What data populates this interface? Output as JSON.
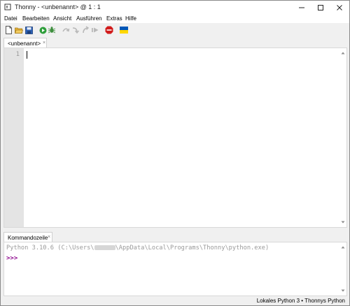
{
  "window": {
    "title": "Thonny  -  <unbenannt>  @  1 : 1"
  },
  "menu": {
    "items": [
      "Datei",
      "Bearbeiten",
      "Ansicht",
      "Ausführen",
      "Extras",
      "Hilfe"
    ]
  },
  "toolbar": {
    "icons": [
      "new-file-icon",
      "open-folder-icon",
      "save-icon",
      "run-icon",
      "debug-icon",
      "step-over-icon",
      "step-into-icon",
      "step-out-icon",
      "resume-icon",
      "stop-icon",
      "ukraine-flag-icon"
    ],
    "colors": {
      "run": "#2e9e3a",
      "stop": "#d11b1b",
      "flag_blue": "#0057b7",
      "flag_yellow": "#ffd700",
      "save": "#2b5fb3",
      "folder": "#e6b23c"
    }
  },
  "editor": {
    "tab_label": "<unbenannt>",
    "tab_close": "×",
    "line_numbers": [
      "1"
    ]
  },
  "shell": {
    "tab_label": "Kommandozeile",
    "tab_close": "×",
    "banner_prefix": "Python 3.10.6 (C:\\Users\\",
    "banner_suffix": "\\AppData\\Local\\Programs\\Thonny\\python.exe)",
    "prompt": ">>>",
    "prompt_color": "#8b008b"
  },
  "status": {
    "text": "Lokales Python 3  •  Thonnys Python"
  }
}
